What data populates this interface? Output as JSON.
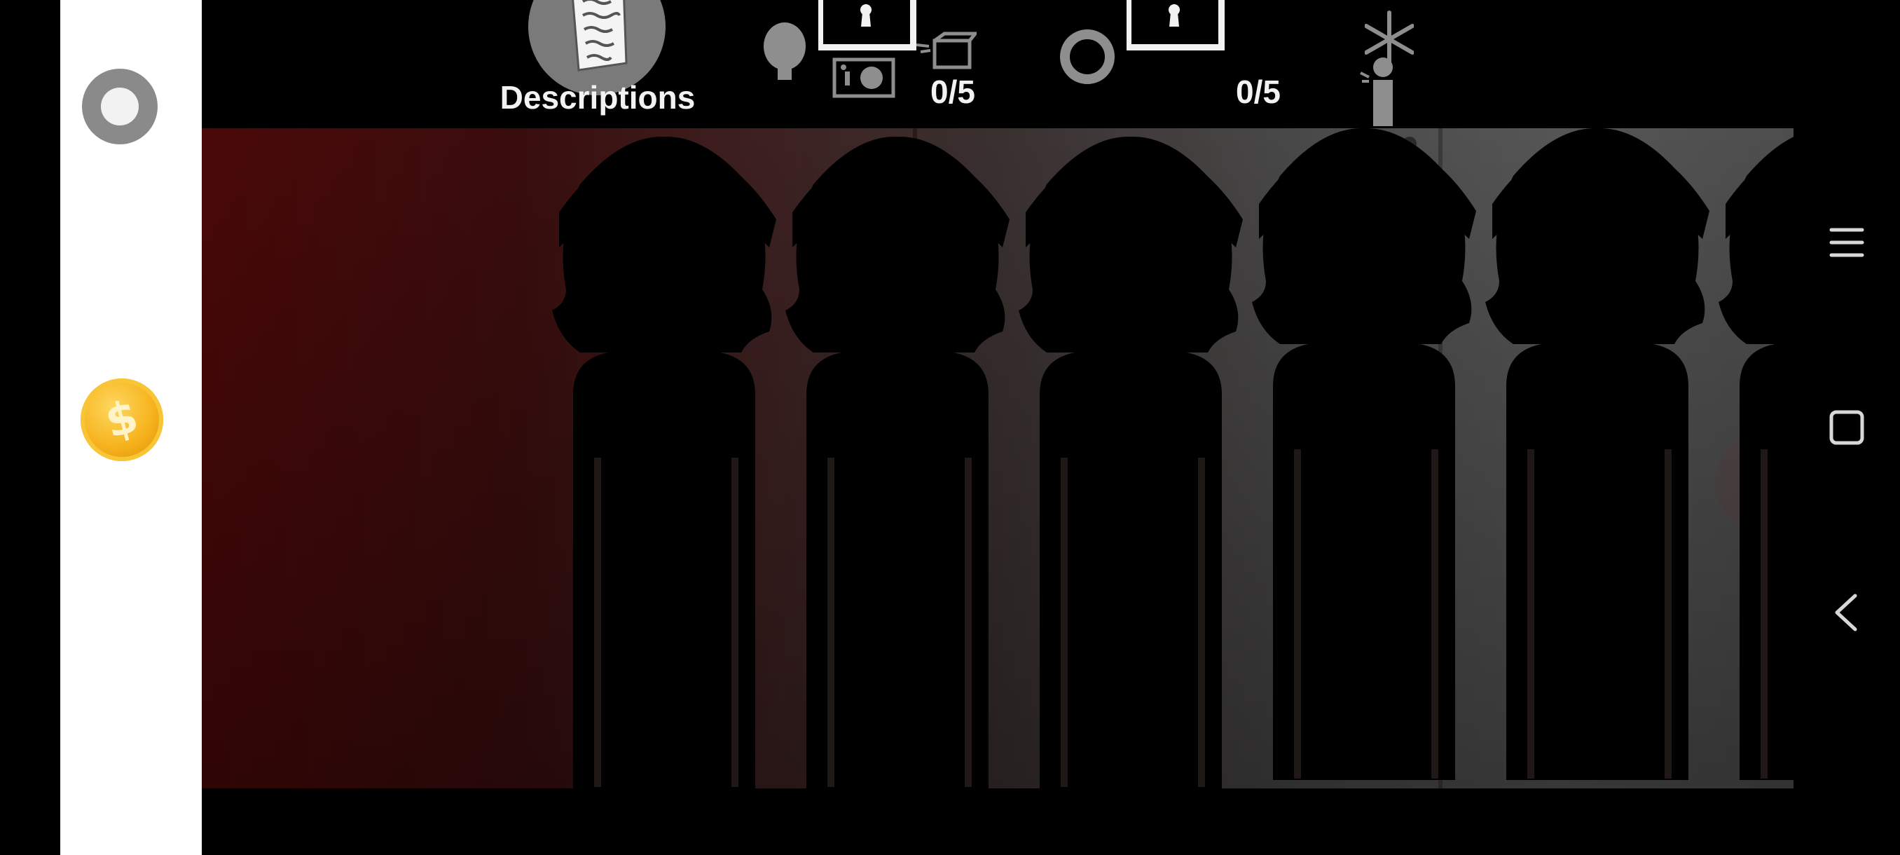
{
  "side_panel": {
    "record_button": "record",
    "coin_button": "coin"
  },
  "hud": {
    "descriptions_label": "Descriptions",
    "counter_left": "0/5",
    "counter_right": "0/5"
  },
  "scene": {
    "silhouette_count": 6
  },
  "nav": {
    "menu_icon": "menu-icon",
    "home_icon": "square-icon",
    "back_icon": "back-icon"
  },
  "colors": {
    "panel": "#ffffff",
    "scene_left": "#4a0808",
    "scene_right": "#555555",
    "hud_text": "#f2f2f2"
  }
}
